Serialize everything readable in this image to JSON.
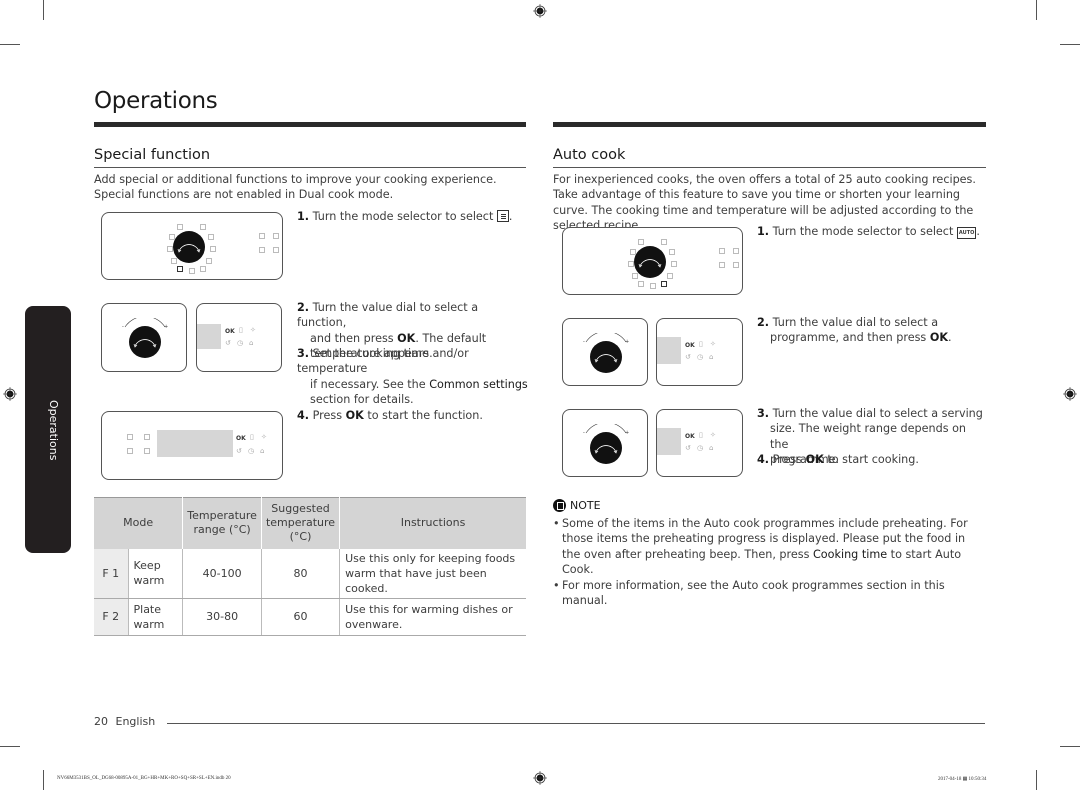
{
  "page": {
    "title": "Operations",
    "side_tab": "Operations",
    "footer": {
      "page_number": "20",
      "language": "English"
    },
    "print_info": {
      "file": "NV66M3531BS_OL_DG68-00895A-01_BG+HR+MK+RO+SQ+SR+SL+EN.indb   20",
      "timestamp": "2017-04-18   ▦ 10:50:34"
    }
  },
  "special_function": {
    "heading": "Special function",
    "intro": "Add special or additional functions to improve your cooking experience. Special functions are not enabled in Dual cook mode.",
    "steps": [
      {
        "num": "1.",
        "text": "Turn the mode selector to select",
        "icon": "special-function-icon"
      },
      {
        "num": "2.",
        "lines": [
          "Turn the value dial to select a function,",
          "and then press ",
          "OK",
          ". The default",
          "temperature appears."
        ]
      },
      {
        "num": "3.",
        "lines": [
          "Set the cooking time and/or temperature",
          "if necessary. See the ",
          "Common settings",
          "section for details."
        ]
      },
      {
        "num": "4.",
        "pre": "Press ",
        "bold": "OK",
        "post": " to start the function."
      }
    ],
    "panel_labels": {
      "ok": "OK"
    },
    "table": {
      "headers": [
        "Mode",
        "Temperature range (°C)",
        "Suggested temperature (°C)",
        "Instructions"
      ],
      "header_lines": {
        "temp_range": [
          "Temperature",
          "range (°C)"
        ],
        "suggested": [
          "Suggested",
          "temperature",
          "(°C)"
        ]
      },
      "rows": [
        {
          "code": "F 1",
          "mode": "Keep warm",
          "range": "40-100",
          "suggested": "80",
          "instructions": "Use this only for keeping foods warm that have just been cooked."
        },
        {
          "code": "F 2",
          "mode": "Plate warm",
          "range": "30-80",
          "suggested": "60",
          "instructions": "Use this for warming dishes or ovenware."
        }
      ]
    }
  },
  "auto_cook": {
    "heading": "Auto cook",
    "intro": "For inexperienced cooks, the oven offers a total of 25 auto cooking recipes. Take advantage of this feature to save you time or shorten your learning curve. The cooking time and temperature will be adjusted according to the selected recipe.",
    "steps": [
      {
        "num": "1.",
        "text": "Turn the mode selector to select",
        "icon": "auto-icon",
        "icon_label": "AUTO"
      },
      {
        "num": "2.",
        "line1": "Turn the value dial to select a",
        "line2_pre": "programme, and then press ",
        "line2_bold": "OK",
        "line2_post": "."
      },
      {
        "num": "3.",
        "lines": [
          "Turn the value dial to select a serving",
          "size. The weight range depends on the",
          "programme."
        ]
      },
      {
        "num": "4.",
        "pre": "Press ",
        "bold": "OK",
        "post": " to start cooking."
      }
    ],
    "note": {
      "label": "NOTE",
      "items": [
        {
          "pre": "Some of the items in the Auto cook programmes include preheating. For those items the preheating progress is displayed. Please put the food in the oven after preheating beep. Then, press ",
          "bold": "Cooking time",
          "post": " to start Auto Cook."
        },
        {
          "pre": "For more information, see the Auto cook programmes section in this manual.",
          "bold": "",
          "post": ""
        }
      ]
    }
  }
}
